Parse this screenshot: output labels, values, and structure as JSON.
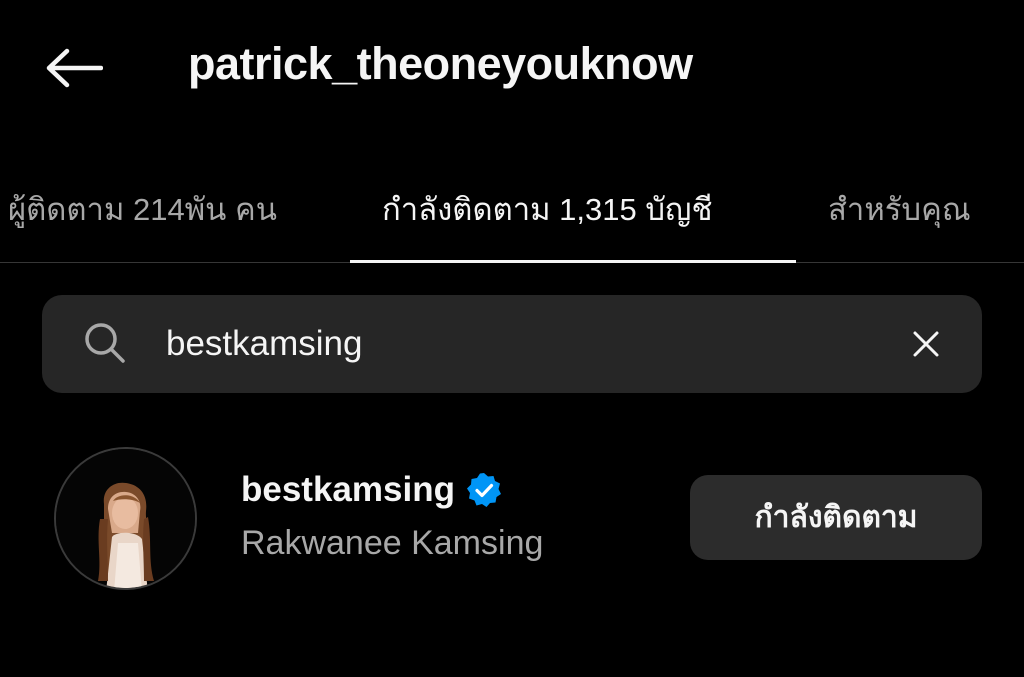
{
  "header": {
    "back_icon": "arrow-left-icon",
    "title": "patrick_theoneyouknow"
  },
  "tabs": [
    {
      "label": "ผู้ติดตาม 214พัน คน",
      "active": false
    },
    {
      "label": "กำลังติดตาม 1,315 บัญชี",
      "active": true
    },
    {
      "label": "สำหรับคุณ",
      "active": false
    }
  ],
  "search": {
    "icon": "search-icon",
    "value": "bestkamsing",
    "clear_icon": "close-icon"
  },
  "results": [
    {
      "username": "bestkamsing",
      "verified": true,
      "full_name": "Rakwanee Kamsing",
      "button_label": "กำลังติดตาม"
    }
  ],
  "colors": {
    "background": "#000000",
    "surface": "#262626",
    "primary_text": "#f5f5f5",
    "secondary_text": "#a8a8a8",
    "verified_blue": "#0095f6"
  }
}
